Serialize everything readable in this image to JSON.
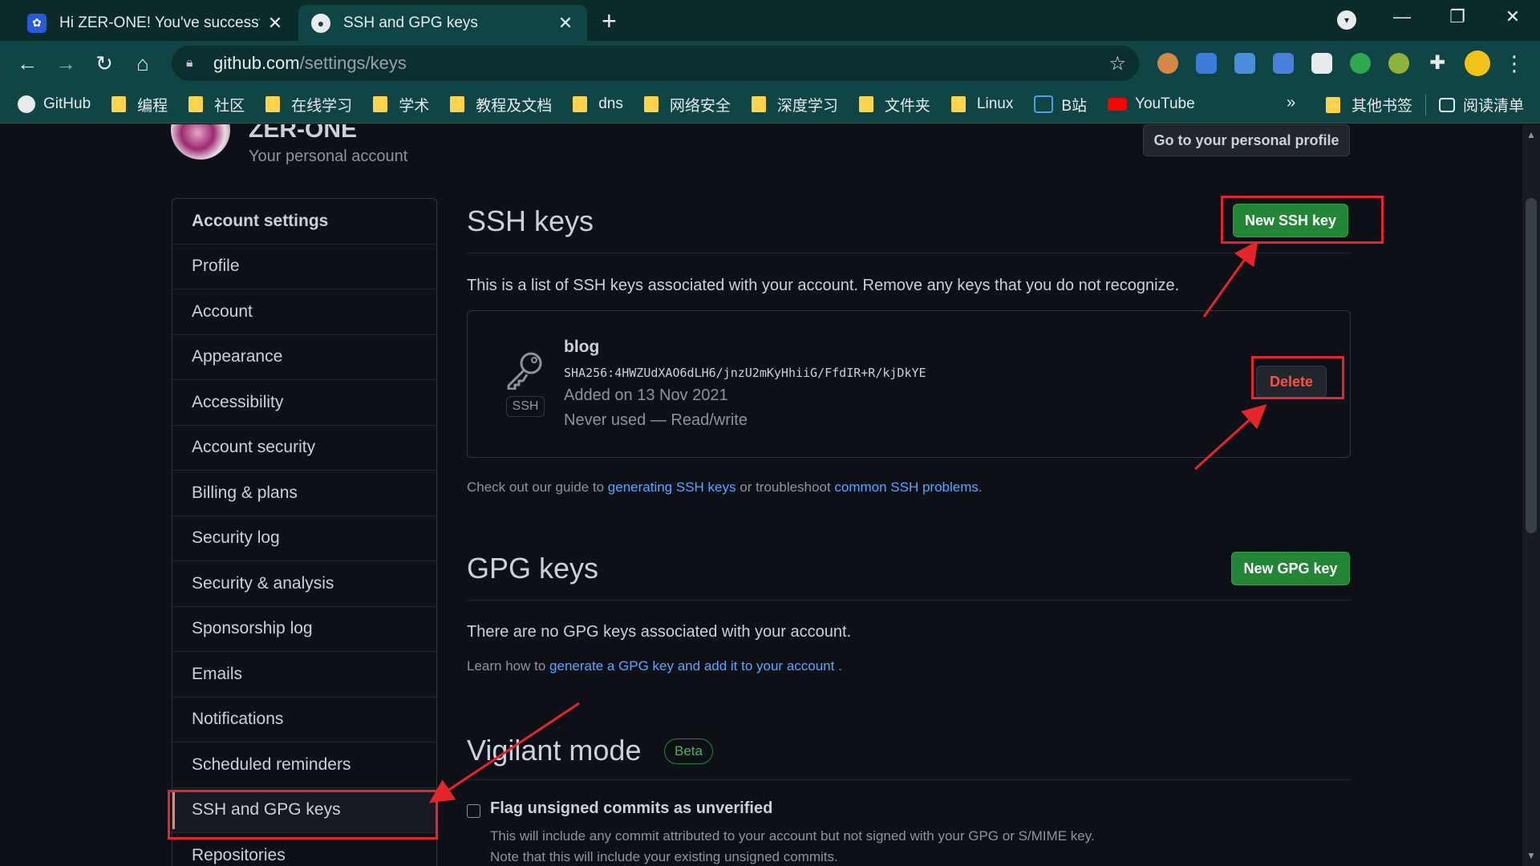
{
  "tabs": [
    {
      "title": "Hi ZER-ONE! You've successfully",
      "close": "✕"
    },
    {
      "title": "SSH and GPG keys",
      "close": "✕"
    }
  ],
  "omnibox": {
    "host": "github.com",
    "path": "/settings/keys"
  },
  "bookmarks": [
    {
      "label": "GitHub",
      "icon": "github-icon"
    },
    {
      "label": "编程",
      "icon": "folder-icon"
    },
    {
      "label": "社区",
      "icon": "folder-icon"
    },
    {
      "label": "在线学习",
      "icon": "folder-icon"
    },
    {
      "label": "学术",
      "icon": "folder-icon"
    },
    {
      "label": "教程及文档",
      "icon": "folder-icon"
    },
    {
      "label": "dns",
      "icon": "folder-icon"
    },
    {
      "label": "网络安全",
      "icon": "folder-icon"
    },
    {
      "label": "深度学习",
      "icon": "folder-icon"
    },
    {
      "label": "文件夹",
      "icon": "folder-icon"
    },
    {
      "label": "Linux",
      "icon": "folder-icon"
    },
    {
      "label": "B站",
      "icon": "bilibili-icon"
    },
    {
      "label": "YouTube",
      "icon": "youtube-icon"
    }
  ],
  "bookmarks_more": "»",
  "other_bookmarks": "其他书签",
  "reading_list": "阅读清单",
  "header": {
    "name": "ZER-ONE",
    "subtitle": "Your personal account",
    "profile_button": "Go to your personal profile"
  },
  "sidebar": {
    "items": [
      {
        "label": "Account settings"
      },
      {
        "label": "Profile"
      },
      {
        "label": "Account"
      },
      {
        "label": "Appearance"
      },
      {
        "label": "Accessibility"
      },
      {
        "label": "Account security"
      },
      {
        "label": "Billing & plans"
      },
      {
        "label": "Security log"
      },
      {
        "label": "Security & analysis"
      },
      {
        "label": "Sponsorship log"
      },
      {
        "label": "Emails"
      },
      {
        "label": "Notifications"
      },
      {
        "label": "Scheduled reminders"
      },
      {
        "label": "SSH and GPG keys"
      },
      {
        "label": "Repositories"
      }
    ]
  },
  "ssh": {
    "heading": "SSH keys",
    "new_button": "New SSH key",
    "intro": "This is a list of SSH keys associated with your account. Remove any keys that you do not recognize.",
    "key": {
      "title": "blog",
      "fingerprint": "SHA256:4HWZUdXAO6dLH6/jnzU2mKyHhiiG/FfdIR+R/kjDkYE",
      "added": "Added on 13 Nov 2021",
      "usage": "Never used — Read/write",
      "badge": "SSH",
      "delete_button": "Delete"
    },
    "guide_prefix": "Check out our guide to",
    "guide_link": "generating SSH keys",
    "guide_middle": "or troubleshoot",
    "problems_link": "common SSH problems",
    "guide_suffix": "."
  },
  "gpg": {
    "heading": "GPG keys",
    "new_button": "New GPG key",
    "empty": "There are no GPG keys associated with your account.",
    "learn_prefix": "Learn how to",
    "learn_link": "generate a GPG key and add it to your account",
    "learn_suffix": "."
  },
  "vigilant": {
    "heading": "Vigilant mode",
    "badge": "Beta",
    "checkbox_label": "Flag unsigned commits as unverified",
    "desc1": "This will include any commit attributed to your account but not signed with your GPG or S/MIME key.",
    "desc2": "Note that this will include your existing unsigned commits."
  },
  "colors": {
    "green": "#238636",
    "danger": "#f85149",
    "link": "#58a6ff",
    "annotation": "#e5252a",
    "chrome": "#0f4545"
  }
}
